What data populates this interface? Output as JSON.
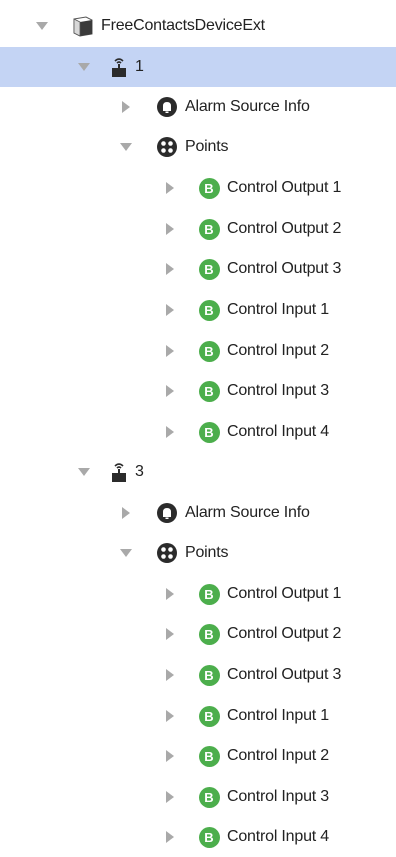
{
  "tree": {
    "root": {
      "label": "FreeContactsDeviceExt",
      "icon": "folder-module-icon",
      "expanded": true
    },
    "devices": [
      {
        "label": "1",
        "icon": "wireless-device-icon",
        "selected": true,
        "expanded": true,
        "alarm": {
          "label": "Alarm Source Info",
          "icon": "alarm-bell-icon"
        },
        "points": {
          "label": "Points",
          "icon": "points-folder-icon",
          "expanded": true,
          "badge": "B",
          "items": [
            "Control Output 1",
            "Control Output 2",
            "Control Output 3",
            "Control Input 1",
            "Control Input 2",
            "Control Input 3",
            "Control Input 4"
          ]
        }
      },
      {
        "label": "3",
        "icon": "wireless-device-icon",
        "selected": false,
        "expanded": true,
        "alarm": {
          "label": "Alarm Source Info",
          "icon": "alarm-bell-icon"
        },
        "points": {
          "label": "Points",
          "icon": "points-folder-icon",
          "expanded": true,
          "badge": "B",
          "items": [
            "Control Output 1",
            "Control Output 2",
            "Control Output 3",
            "Control Input 1",
            "Control Input 2",
            "Control Input 3",
            "Control Input 4"
          ]
        }
      }
    ]
  },
  "colors": {
    "selection": "#c4d4f4",
    "badge_green": "#4cae4c",
    "toggle_gray": "#a9a9a9",
    "icon_dark": "#2b2b2b"
  }
}
